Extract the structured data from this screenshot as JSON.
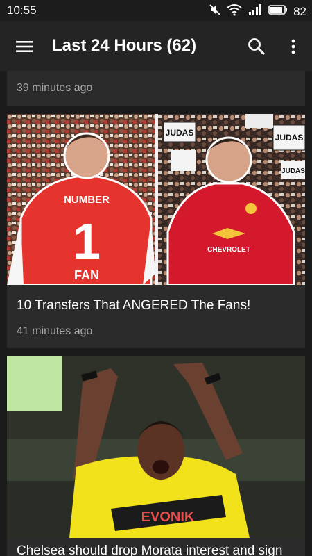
{
  "status_bar": {
    "time": "10:55",
    "battery": "82",
    "icons": [
      "mute-icon",
      "wifi-icon",
      "signal-icon",
      "battery-icon"
    ]
  },
  "toolbar": {
    "title": "Last 24 Hours (62)",
    "icons": [
      "menu-icon",
      "search-icon",
      "more-vert-icon"
    ]
  },
  "feed": {
    "items": [
      {
        "time_ago": "39 minutes ago"
      },
      {
        "title": "10 Transfers That ANGERED The Fans!",
        "time_ago": "41 minutes ago"
      },
      {
        "title": "Chelsea should drop Morata interest and sign"
      }
    ]
  },
  "colors": {
    "background": "#1b1b1b",
    "toolbar": "#242424",
    "card": "#2b2b2b",
    "text": "#ffffff",
    "meta_text": "#a9a9a9"
  }
}
